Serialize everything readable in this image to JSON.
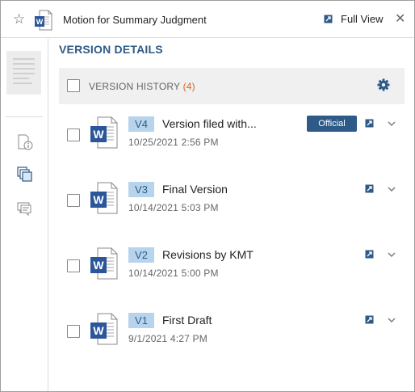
{
  "header": {
    "title": "Motion for Summary Judgment",
    "full_view_label": "Full View",
    "close_glyph": "✕",
    "star_glyph": "☆",
    "icons": [
      "star-icon",
      "word-doc-icon",
      "external-link-icon",
      "close-icon"
    ]
  },
  "rail": {
    "icons": [
      "document-info-icon",
      "versions-icon",
      "comments-icon"
    ]
  },
  "main": {
    "section_title": "VERSION DETAILS",
    "version_history": {
      "label": "VERSION HISTORY",
      "count_open": "(",
      "count": "4",
      "count_close": ")",
      "settings_icon": "gear-icon"
    },
    "versions": [
      {
        "badge": "V4",
        "name": "Version filed with...",
        "date": "10/25/2021 2:56 PM",
        "official_label": "Official"
      },
      {
        "badge": "V3",
        "name": "Final Version",
        "date": "10/14/2021 5:03 PM"
      },
      {
        "badge": "V2",
        "name": "Revisions by KMT",
        "date": "10/14/2021 5:00 PM"
      },
      {
        "badge": "V1",
        "name": "First Draft",
        "date": "9/1/2021 4:27 PM"
      }
    ]
  },
  "colors": {
    "accent": "#2e5a87",
    "badge_bg": "#b8d4ec",
    "count": "#d2691e",
    "word_blue": "#2b579a"
  }
}
